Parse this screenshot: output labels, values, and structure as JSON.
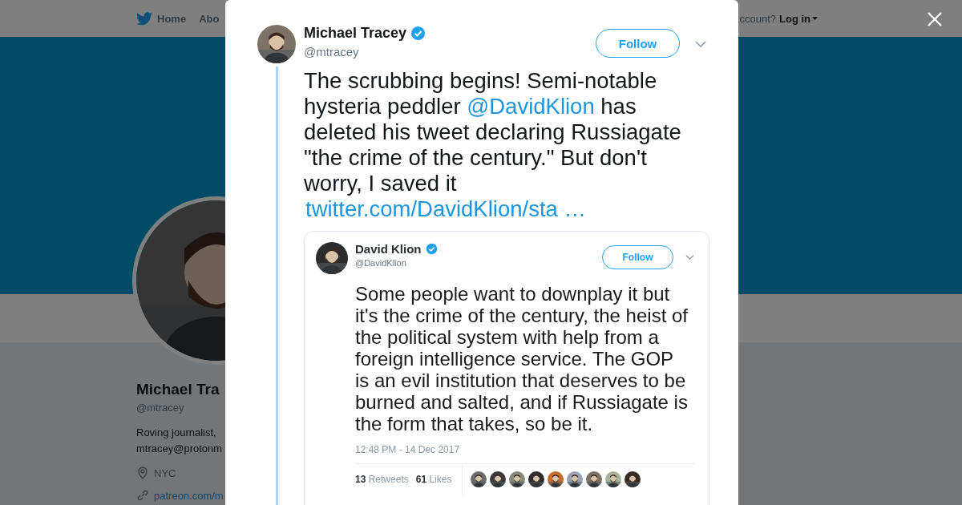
{
  "background_page": {
    "nav": [
      {
        "label": "Home",
        "kind": "home"
      },
      {
        "label": "Abo",
        "kind": "plain"
      }
    ],
    "account": {
      "prompt": "ccount?",
      "login": "Log in"
    },
    "profile": {
      "name": "Michael Tra",
      "handle": "@mtracey",
      "bio": [
        "Roving journalist,",
        "mtracey@protonm"
      ],
      "location": "NYC",
      "link": "patreon.com/m"
    }
  },
  "modal": {
    "tweet": {
      "author": {
        "name": "Michael Tracey",
        "verified": true,
        "handle": "@mtracey"
      },
      "follow": "Follow",
      "text": [
        {
          "kind": "plain",
          "text": "The scrubbing begins! Semi-notable hysteria peddler "
        },
        {
          "kind": "mention",
          "text": "@DavidKlion"
        },
        {
          "kind": "plain",
          "text": " has deleted his tweet declaring Russiagate \"the crime of the century.\" But don't worry, I saved it"
        }
      ],
      "link": "twitter.com/DavidKlion/sta …",
      "embedded_screenshot": {
        "author": {
          "name": "David Klion",
          "verified": true,
          "handle": "@DavidKlion"
        },
        "follow": "Follow",
        "text": "Some people want to downplay it but it's the crime of the century, the heist of the political system with help from a foreign intelligence service. The GOP is an evil institution that deserves to be burned and salted, and if Russiagate is the form that takes, so be it.",
        "timestamp": "12:48 PM - 14 Dec 2017",
        "stats": [
          "**13** Retweets",
          "**61** Likes"
        ],
        "likers": [
          {
            "kind": "picture"
          },
          {
            "kind": "picture"
          },
          {
            "kind": "picture"
          },
          {
            "kind": "picture"
          },
          {
            "kind": "picture"
          },
          {
            "kind": "picture"
          },
          {
            "kind": "picture"
          },
          {
            "kind": "picture"
          },
          {
            "kind": "picture"
          }
        ]
      }
    }
  }
}
